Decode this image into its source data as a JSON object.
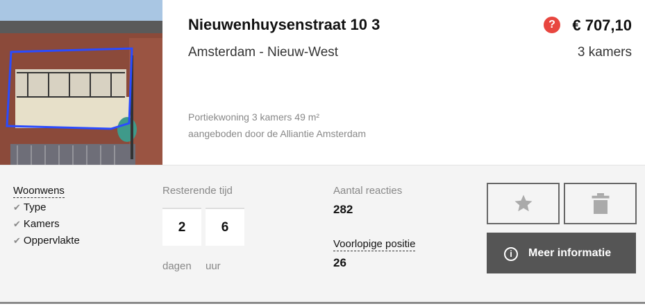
{
  "listing": {
    "street": "Nieuwenhuysenstraat 10 3",
    "city": "Amsterdam - Nieuw-West",
    "price": "€ 707,10",
    "rooms": "3 kamers",
    "description_line1": "Portiekwoning 3 kamers 49 m²",
    "description_line2": "aangeboden door de Alliantie Amsterdam",
    "help_glyph": "?"
  },
  "woonwens": {
    "title": "Woonwens",
    "items": [
      "Type",
      "Kamers",
      "Oppervlakte"
    ],
    "check_glyph": "✔"
  },
  "remaining": {
    "label": "Resterende tijd",
    "days_value": "2",
    "hours_value": "6",
    "days_label": "dagen",
    "hours_label": "uur"
  },
  "stats": {
    "reactions_label": "Aantal reacties",
    "reactions_value": "282",
    "position_label": "Voorlopige positie",
    "position_value": "26"
  },
  "actions": {
    "favorite_icon": "star-icon",
    "delete_icon": "trash-icon",
    "more_label": "Meer informatie",
    "info_glyph": "i"
  },
  "colors": {
    "help_badge": "#e8463f",
    "more_button": "#555555",
    "panel_bg": "#f4f4f4"
  }
}
